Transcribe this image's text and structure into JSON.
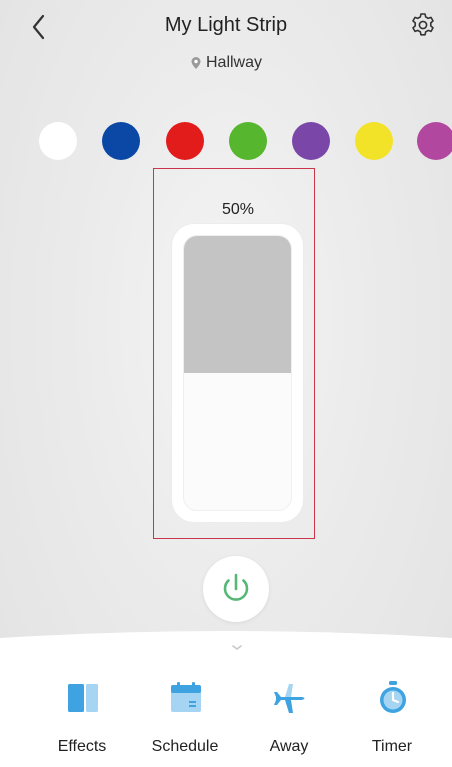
{
  "header": {
    "title": "My Light Strip",
    "location": "Hallway"
  },
  "colors": [
    "#ffffff",
    "#0b47a5",
    "#e21b1b",
    "#56b62d",
    "#7a47a9",
    "#f2e328",
    "#b1479e"
  ],
  "brightness": {
    "label": "50%",
    "value": 0.5
  },
  "nav": {
    "items": [
      {
        "label": "Effects",
        "icon": "effects-icon"
      },
      {
        "label": "Schedule",
        "icon": "schedule-icon"
      },
      {
        "label": "Away",
        "icon": "airplane-icon"
      },
      {
        "label": "Timer",
        "icon": "timer-icon"
      }
    ]
  },
  "accent": "#5ab7e8",
  "power_color": "#55b875"
}
